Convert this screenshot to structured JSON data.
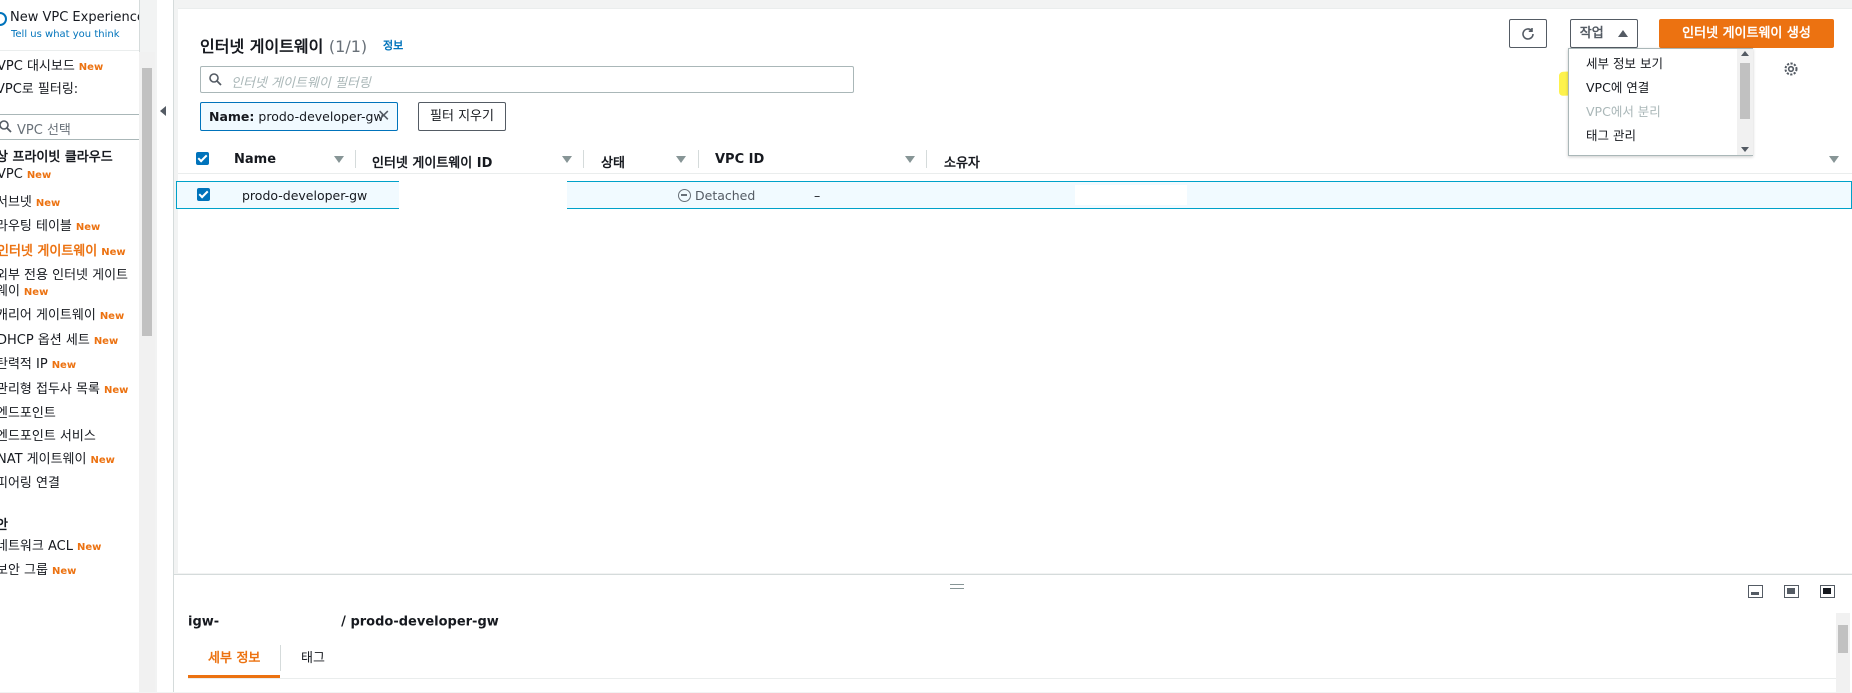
{
  "sidebar": {
    "new_vpc_experience": "New VPC Experience",
    "feedback_link": "Tell us what you think",
    "dashboard": "VPC 대시보드",
    "filter_label": "VPC로 필터링:",
    "vpc_select_placeholder": "VPC 선택",
    "section_vpc": "상 프라이빗 클라우드",
    "new_badge": "New",
    "items": [
      {
        "label": "VPC"
      },
      {
        "label": "서브넷"
      },
      {
        "label": "라우팅 테이블"
      },
      {
        "label": "인터넷 게이트웨이"
      },
      {
        "label": "외부 전용 인터넷 게이트"
      },
      {
        "label": "웨이"
      },
      {
        "label": "캐리어 게이트웨이"
      },
      {
        "label": "DHCP 옵션 세트"
      },
      {
        "label": "탄력적 IP"
      },
      {
        "label": "관리형 접두사 목록"
      },
      {
        "label": "엔드포인트"
      },
      {
        "label": "엔드포인트 서비스"
      },
      {
        "label": "NAT 게이트웨이"
      },
      {
        "label": "피어링 연결"
      }
    ],
    "section_security": "안",
    "security_items": [
      {
        "label": "네트워크 ACL"
      },
      {
        "label": "보안 그룹"
      }
    ]
  },
  "header": {
    "title": "인터넷 게이트웨이",
    "count": "(1/1)",
    "info": "정보",
    "refresh_icon": "refresh-icon",
    "actions_label": "작업",
    "create_label": "인터넷 게이트웨이 생성"
  },
  "search": {
    "placeholder": "인터넷 게이트웨이 필터링"
  },
  "filter_token": {
    "key": "Name:",
    "value": "prodo-developer-gw",
    "clear_label": "필터 지우기"
  },
  "actions_menu": [
    {
      "label": "세부 정보 보기",
      "disabled": false
    },
    {
      "label": "VPC에 연결",
      "disabled": false
    },
    {
      "label": "VPC에서 분리",
      "disabled": true
    },
    {
      "label": "태그 관리",
      "disabled": false
    }
  ],
  "table": {
    "columns": [
      "Name",
      "인터넷 게이트웨이 ID",
      "상태",
      "VPC ID",
      "소유자"
    ],
    "rows": [
      {
        "name": "prodo-developer-gw",
        "id": "",
        "state": "Detached",
        "vpc_id": "–",
        "owner": ""
      }
    ]
  },
  "details": {
    "title_prefix": "igw-",
    "title_suffix": "/ prodo-developer-gw",
    "tabs": [
      "세부 정보",
      "태그"
    ]
  },
  "colors": {
    "accent": "#ec7211",
    "link": "#0073bb",
    "highlight": "#fdf24d"
  }
}
